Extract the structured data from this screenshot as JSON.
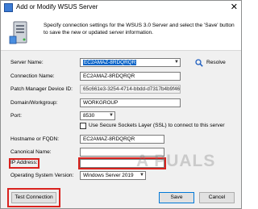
{
  "window": {
    "title": "Add or Modify WSUS Server",
    "close_glyph": "✕"
  },
  "header": {
    "description": "Specify connection settings for the WSUS 3.0 Server and select the 'Save' button to save the new or updated server information."
  },
  "form": {
    "server_name_label": "Server Name:",
    "server_name_value": "EC2AMAZ-8RDQRQR",
    "resolve_label": "Resolve",
    "connection_name_label": "Connection Name:",
    "connection_name_value": "EC2AMAZ-8RDQRQR",
    "patch_manager_id_label": "Patch Manager Device ID:",
    "patch_manager_id_value": "65c661e3-3254-4714-bbdd-d7317b4b9f46",
    "domain_label": "Domain/Workgroup:",
    "domain_value": "WORKGROUP",
    "port_label": "Port:",
    "port_value": "8530",
    "ssl_label": "Use Secure Sockets Layer (SSL) to connect to this server",
    "hostname_label": "Hostname or FQDN:",
    "hostname_value": "EC2AMAZ-8RDQRQR",
    "canonical_label": "Canonical Name:",
    "canonical_value": "",
    "ip_label": "IP Address:",
    "ip_value": "",
    "os_label": "Operating System Version:",
    "os_value": "Windows Server 2019"
  },
  "buttons": {
    "test_connection": "Test Connection",
    "save": "Save",
    "cancel": "Cancel"
  },
  "watermark": "A PUALS",
  "colors": {
    "highlight_box": "#d9221e",
    "selection": "#0a64c8"
  }
}
